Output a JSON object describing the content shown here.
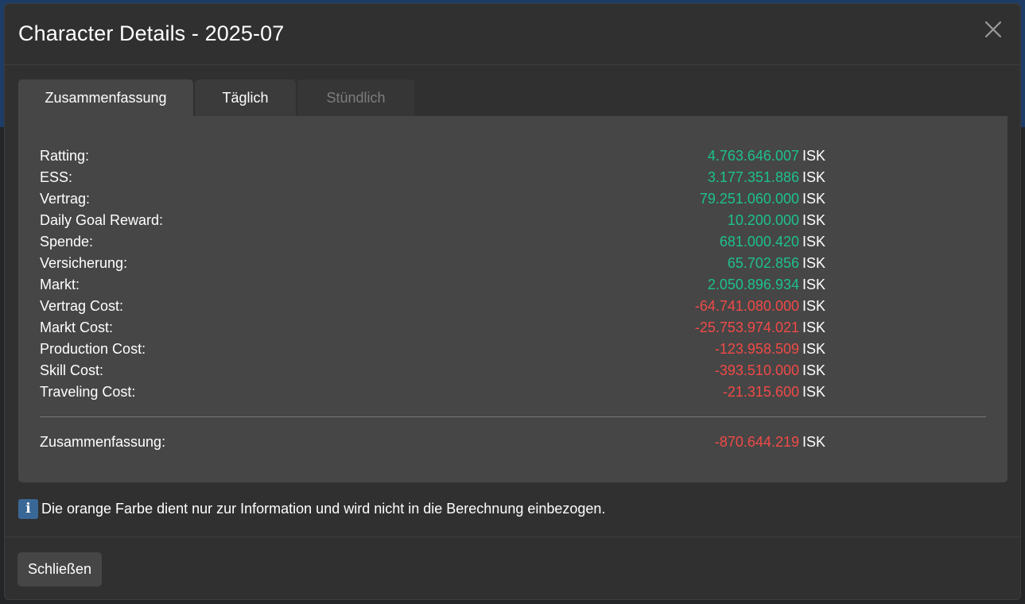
{
  "modal": {
    "title": "Character Details - 2025-07",
    "close_icon": "close-icon"
  },
  "tabs": [
    {
      "label": "Zusammenfassung",
      "state": "active"
    },
    {
      "label": "Täglich",
      "state": "normal"
    },
    {
      "label": "Stündlich",
      "state": "disabled"
    }
  ],
  "rows": [
    {
      "label": "Ratting:",
      "amount": "4.763.646.007",
      "unit": "ISK",
      "sign": "positive"
    },
    {
      "label": "ESS:",
      "amount": "3.177.351.886",
      "unit": "ISK",
      "sign": "positive"
    },
    {
      "label": "Vertrag:",
      "amount": "79.251.060.000",
      "unit": "ISK",
      "sign": "positive"
    },
    {
      "label": "Daily Goal Reward:",
      "amount": "10.200.000",
      "unit": "ISK",
      "sign": "positive"
    },
    {
      "label": "Spende:",
      "amount": "681.000.420",
      "unit": "ISK",
      "sign": "positive"
    },
    {
      "label": "Versicherung:",
      "amount": "65.702.856",
      "unit": "ISK",
      "sign": "positive"
    },
    {
      "label": "Markt:",
      "amount": "2.050.896.934",
      "unit": "ISK",
      "sign": "positive"
    },
    {
      "label": "Vertrag Cost:",
      "amount": "-64.741.080.000",
      "unit": "ISK",
      "sign": "negative"
    },
    {
      "label": "Markt Cost:",
      "amount": "-25.753.974.021",
      "unit": "ISK",
      "sign": "negative"
    },
    {
      "label": "Production Cost:",
      "amount": "-123.958.509",
      "unit": "ISK",
      "sign": "negative"
    },
    {
      "label": "Skill Cost:",
      "amount": "-393.510.000",
      "unit": "ISK",
      "sign": "negative"
    },
    {
      "label": "Traveling Cost:",
      "amount": "-21.315.600",
      "unit": "ISK",
      "sign": "negative"
    }
  ],
  "summary": {
    "label": "Zusammenfassung:",
    "amount": "-870.644.219",
    "unit": "ISK",
    "sign": "negative"
  },
  "info": {
    "icon_glyph": "i",
    "icon": "info-icon",
    "text": "Die orange Farbe dient nur zur Information und wird nicht in die Berechnung einbezogen."
  },
  "footer": {
    "close_label": "Schließen"
  },
  "colors": {
    "positive": "#1dc08d",
    "negative": "#f04a47",
    "text": "#ffffff",
    "info_icon_bg": "#3a6896"
  }
}
